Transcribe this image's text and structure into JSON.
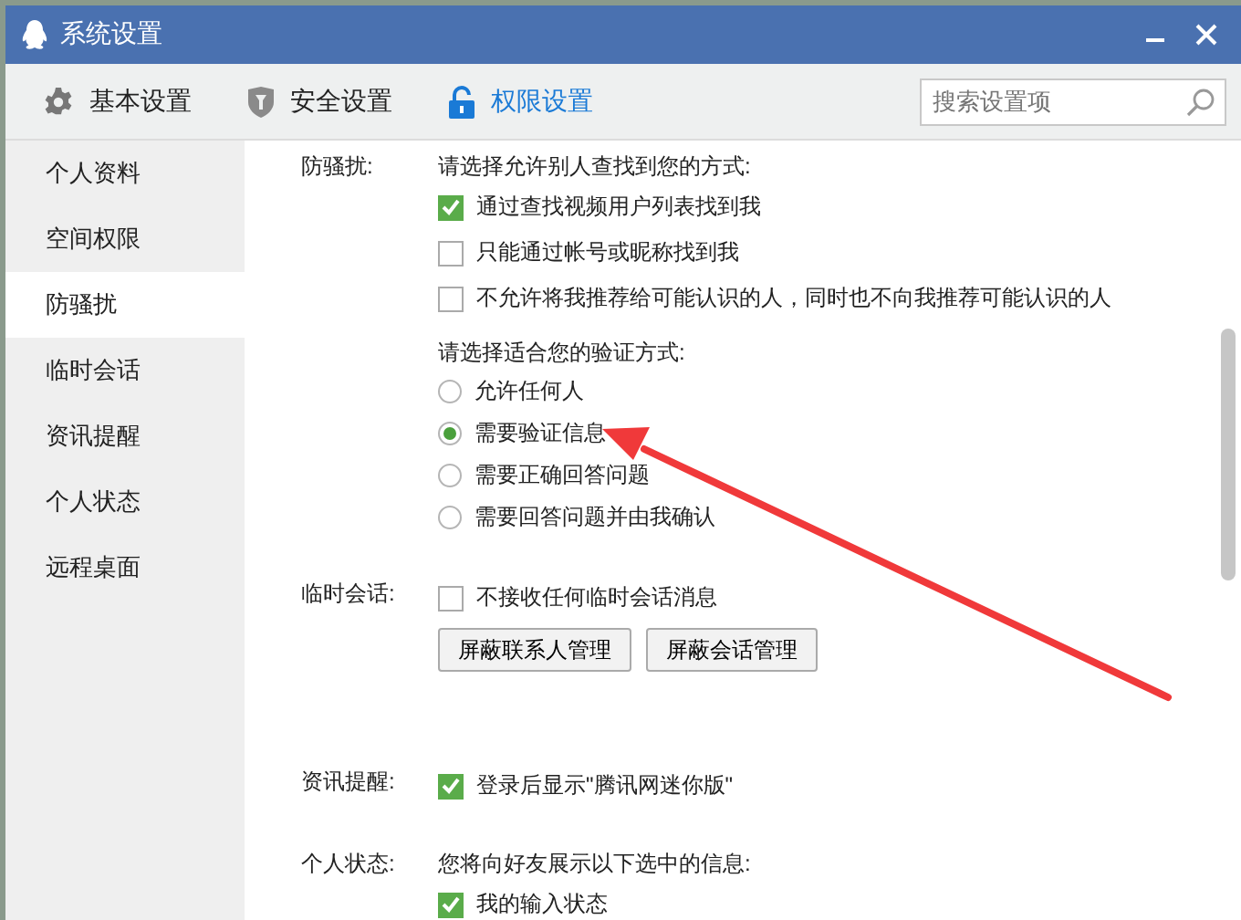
{
  "window": {
    "title": "系统设置"
  },
  "tabs": [
    {
      "label": "基本设置",
      "kind": "gear",
      "selected": false
    },
    {
      "label": "安全设置",
      "kind": "shield",
      "selected": false
    },
    {
      "label": "权限设置",
      "kind": "lock",
      "selected": true
    }
  ],
  "search": {
    "placeholder": "搜索设置项"
  },
  "sidebar": {
    "items": [
      {
        "label": "个人资料",
        "selected": false
      },
      {
        "label": "空间权限",
        "selected": false
      },
      {
        "label": "防骚扰",
        "selected": true
      },
      {
        "label": "临时会话",
        "selected": false
      },
      {
        "label": "资讯提醒",
        "selected": false
      },
      {
        "label": "个人状态",
        "selected": false
      },
      {
        "label": "远程桌面",
        "selected": false
      }
    ]
  },
  "sections": [
    {
      "label": "防骚扰:",
      "rows": [
        {
          "kind": "heading",
          "text": "请选择允许别人查找到您的方式:"
        },
        {
          "kind": "checkbox",
          "text": "通过查找视频用户列表找到我",
          "checked": true
        },
        {
          "kind": "checkbox",
          "text": "只能通过帐号或昵称找到我",
          "checked": false
        },
        {
          "kind": "checkbox",
          "text": "不允许将我推荐给可能认识的人，同时也不向我推荐可能认识的人",
          "checked": false
        },
        {
          "kind": "heading",
          "text": "请选择适合您的验证方式:"
        },
        {
          "kind": "radio",
          "text": "允许任何人",
          "selected": false
        },
        {
          "kind": "radio",
          "text": "需要验证信息",
          "selected": true
        },
        {
          "kind": "radio",
          "text": "需要正确回答问题",
          "selected": false
        },
        {
          "kind": "radio",
          "text": "需要回答问题并由我确认",
          "selected": false
        }
      ]
    },
    {
      "label": "临时会话:",
      "rows": [
        {
          "kind": "checkbox",
          "text": "不接收任何临时会话消息",
          "checked": false
        },
        {
          "kind": "buttons",
          "buttons": [
            "屏蔽联系人管理",
            "屏蔽会话管理"
          ]
        }
      ]
    },
    {
      "label": "资讯提醒:",
      "rows": [
        {
          "kind": "checkbox",
          "text": "登录后显示\"腾讯网迷你版\"",
          "checked": true
        }
      ]
    },
    {
      "label": "个人状态:",
      "rows": [
        {
          "kind": "heading",
          "text": "您将向好友展示以下选中的信息:"
        },
        {
          "kind": "checkbox",
          "text": "我的输入状态",
          "checked": true
        }
      ]
    }
  ]
}
